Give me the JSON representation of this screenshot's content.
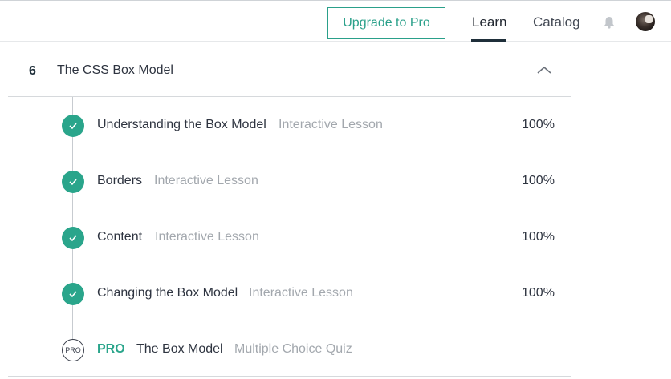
{
  "header": {
    "upgrade_label": "Upgrade to Pro",
    "nav": {
      "learn": "Learn",
      "catalog": "Catalog"
    },
    "icons": {
      "notifications": "bell-icon",
      "profile": "avatar"
    }
  },
  "module": {
    "number": "6",
    "title": "The CSS Box Model",
    "toggle_icon": "chevron-up-icon"
  },
  "lessons": [
    {
      "title": "Understanding the Box Model",
      "type": "Interactive Lesson",
      "progress": "100%",
      "status": "complete"
    },
    {
      "title": "Borders",
      "type": "Interactive Lesson",
      "progress": "100%",
      "status": "complete"
    },
    {
      "title": "Content",
      "type": "Interactive Lesson",
      "progress": "100%",
      "status": "complete"
    },
    {
      "title": "Changing the Box Model",
      "type": "Interactive Lesson",
      "progress": "100%",
      "status": "complete"
    }
  ],
  "pro_item": {
    "badge": "PRO",
    "tag": "PRO",
    "title": "The Box Model",
    "type": "Multiple Choice Quiz"
  },
  "colors": {
    "accent": "#2aa58b",
    "text": "#2e3440",
    "muted": "#a3a8ae"
  }
}
